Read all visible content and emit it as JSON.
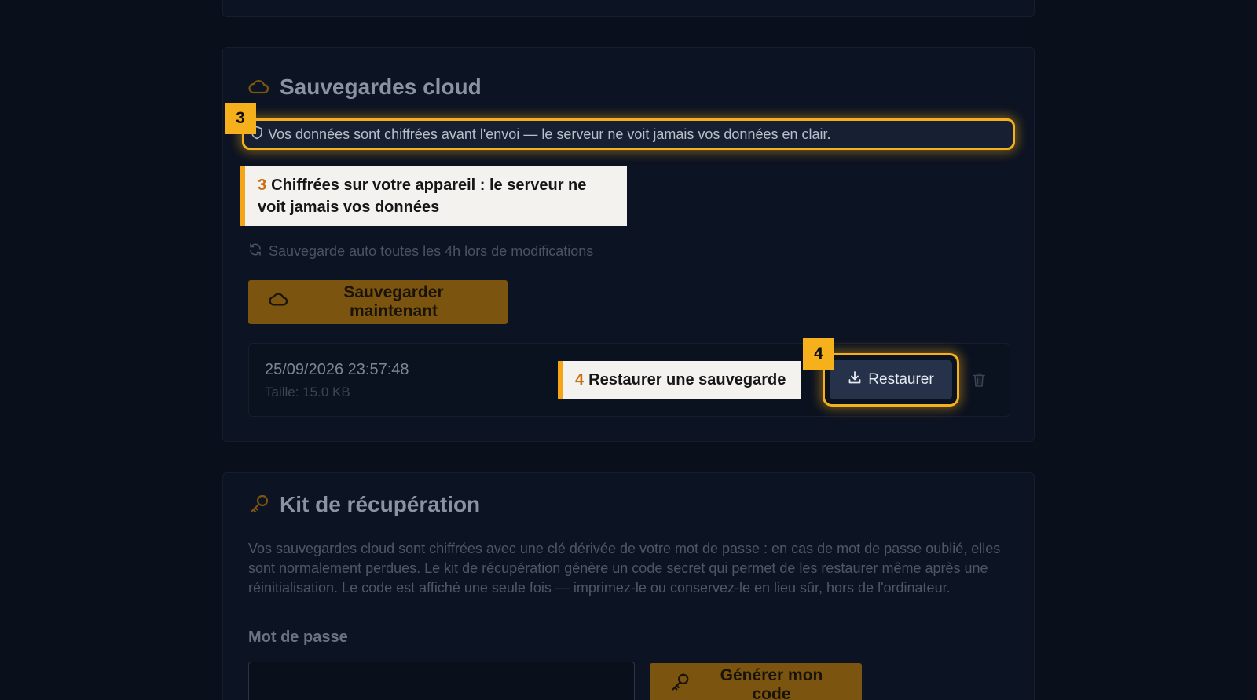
{
  "cloud": {
    "title": "Sauvegardes cloud",
    "encryption_notice": "Vos données sont chiffrées avant l'envoi — le serveur ne voit jamais vos données en clair.",
    "autosave_text": "Sauvegarde auto toutes les 4h lors de modifications",
    "save_now_label": "Sauvegarder maintenant",
    "backups": [
      {
        "date": "25/09/2026 23:57:48",
        "size": "Taille: 15.0 KB",
        "restore_label": "Restaurer"
      }
    ]
  },
  "tutorial": {
    "step3": {
      "badge": "3",
      "number": "3",
      "text": "Chiffrées sur votre appareil : le serveur ne voit jamais vos données"
    },
    "step4": {
      "badge": "4",
      "number": "4",
      "text": "Restaurer une sauvegarde"
    }
  },
  "recovery": {
    "title": "Kit de récupération",
    "description": "Vos sauvegardes cloud sont chiffrées avec une clé dérivée de votre mot de passe : en cas de mot de passe oublié, elles sont normalement perdues. Le kit de récupération génère un code secret qui permet de les restaurer même après une réinitialisation. Le code est affiché une seule fois — imprimez-le ou conservez-le en lieu sûr, hors de l'ordinateur.",
    "password_label": "Mot de passe",
    "password_value": "",
    "generate_label": "Générer mon code"
  },
  "colors": {
    "highlight": "#f5b01b",
    "primary_button": "#7b5410",
    "restore_button": "#25324a",
    "background": "#0a0f1c"
  },
  "icons": [
    "cloud-icon",
    "shield-icon",
    "refresh-icon",
    "download-icon",
    "trash-icon",
    "key-icon"
  ]
}
